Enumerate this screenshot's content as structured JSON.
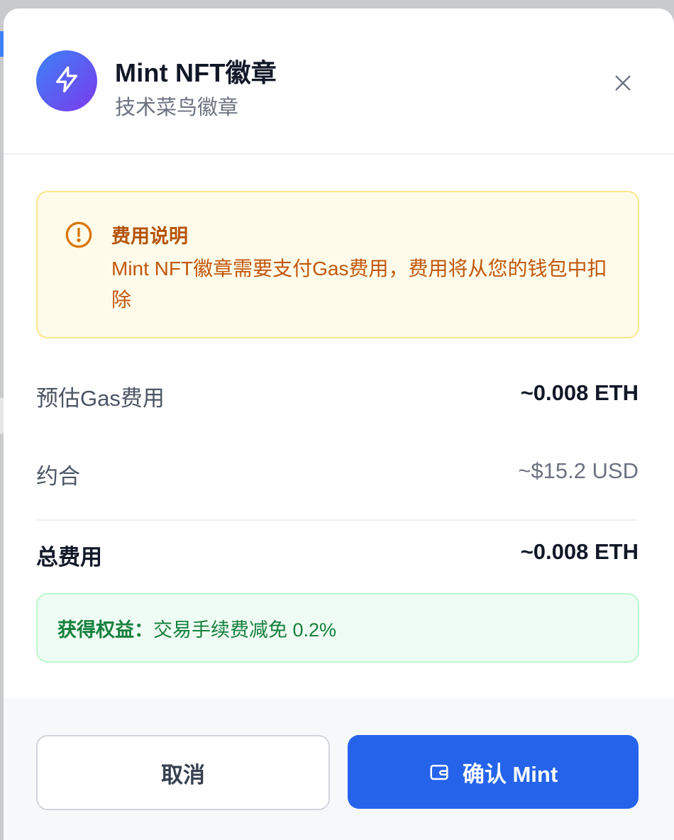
{
  "modal": {
    "title": "Mint NFT徽章",
    "subtitle": "技术菜鸟徽章",
    "avatar_icon": "lightning-icon",
    "close_icon": "close-icon"
  },
  "notice": {
    "icon": "alert-circle-icon",
    "title": "费用说明",
    "text": "Mint NFT徽章需要支付Gas费用，费用将从您的钱包中扣除"
  },
  "fees": {
    "gas_label": "预估Gas费用",
    "gas_value": "~0.008 ETH",
    "usd_label": "约合",
    "usd_value": "~$15.2 USD",
    "total_label": "总费用",
    "total_value": "~0.008 ETH"
  },
  "benefit": {
    "label": "获得权益：",
    "text": "交易手续费减免 0.2%"
  },
  "footer": {
    "cancel_label": "取消",
    "confirm_label": "确认 Mint",
    "confirm_icon": "wallet-icon"
  },
  "colors": {
    "primary": "#2563eb",
    "warning_bg": "#fefbea",
    "warning_text": "#c2570c",
    "success_bg": "#effcf3",
    "success_text": "#15803d"
  }
}
